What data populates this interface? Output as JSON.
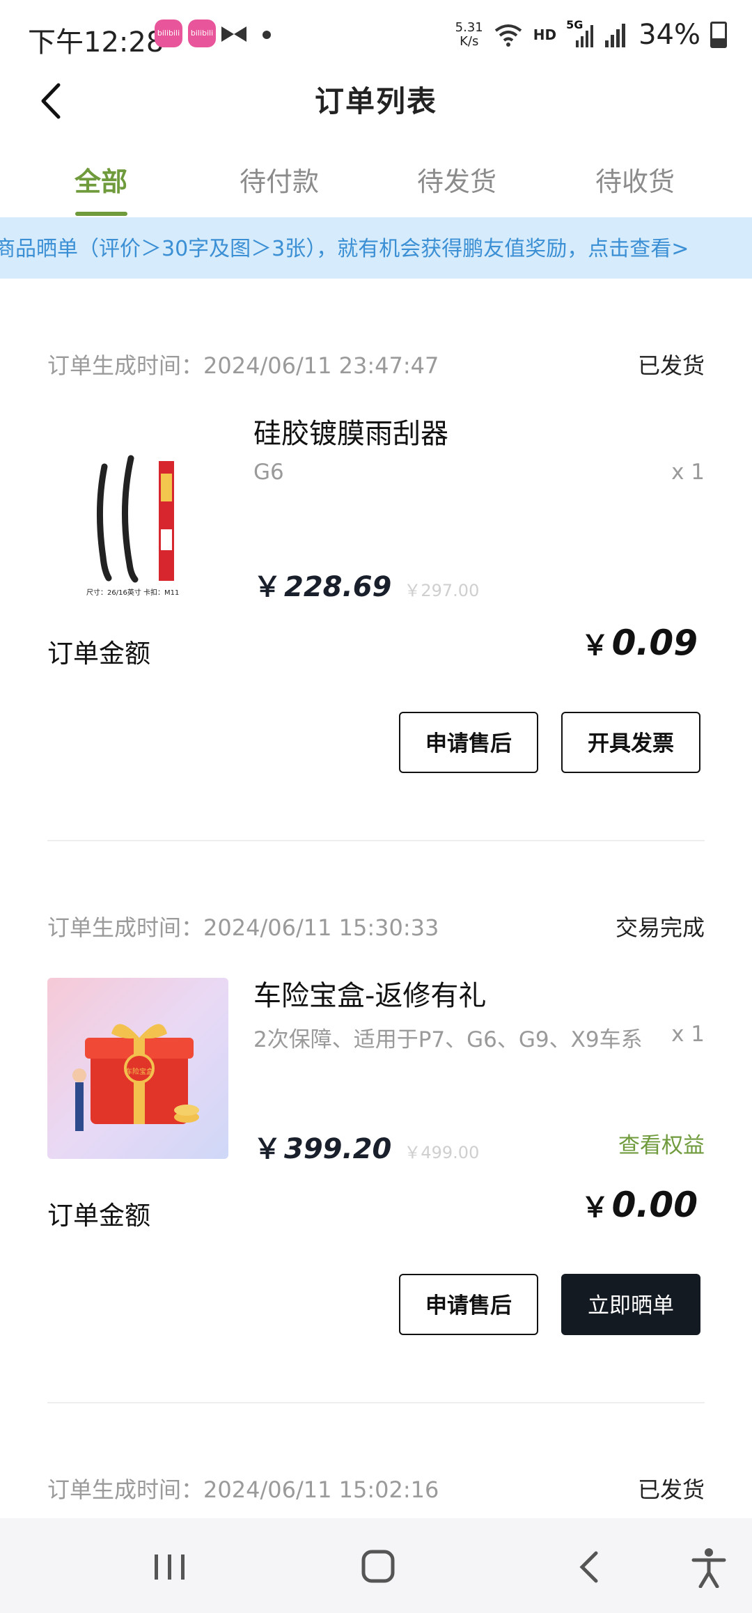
{
  "status_bar": {
    "time": "下午12:28",
    "net_speed_value": "5.31",
    "net_speed_unit": "K/s",
    "hd": "HD",
    "network": "5G",
    "battery": "34%",
    "badge_1": "bilibili",
    "badge_2": "bilibili"
  },
  "header": {
    "title": "订单列表"
  },
  "tabs": [
    {
      "label": "全部",
      "active": true
    },
    {
      "label": "待付款"
    },
    {
      "label": "待发货"
    },
    {
      "label": "待收货"
    }
  ],
  "banner": {
    "text": "商品晒单（评价＞30字及图＞3张），就有机会获得鹏友值奖励，点击查看>"
  },
  "orders": [
    {
      "time": "订单生成时间：2024/06/11 23:47:47",
      "status": "已发货",
      "product_name": "硅胶镀膜雨刮器",
      "spec": "G6",
      "qty": "x 1",
      "price_symbol": "￥",
      "price": "228.69",
      "orig_price": "￥297.00",
      "image_caption": "尺寸：26/16英寸 卡扣：M11",
      "amount_label": "订单金额",
      "amount_symbol": "￥",
      "amount": "0.09",
      "buttons": [
        "申请售后",
        "开具发票"
      ]
    },
    {
      "time": "订单生成时间：2024/06/11 15:30:33",
      "status": "交易完成",
      "product_name": "车险宝盒-返修有礼",
      "spec": "2次保障、适用于P7、G6、G9、X9车系",
      "qty": "x 1",
      "price_symbol": "￥",
      "price": "399.20",
      "orig_price": "￥499.00",
      "link": "查看权益",
      "image_caption": "车险宝盒",
      "amount_label": "订单金额",
      "amount_symbol": "￥",
      "amount": "0.00",
      "buttons": [
        "申请售后",
        "立即晒单"
      ]
    },
    {
      "time": "订单生成时间：2024/06/11 15:02:16",
      "status": "已发货"
    }
  ],
  "colors": {
    "accent_green": "#6f9b3d",
    "banner_bg": "#d6ebfb",
    "banner_text": "#3b8fd4",
    "dark_button": "#141a22"
  }
}
